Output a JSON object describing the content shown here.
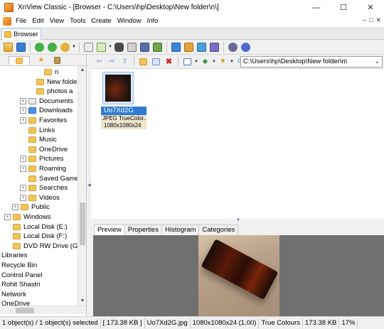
{
  "window": {
    "title": "XnView Classic - [Browser - C:\\Users\\hp\\Desktop\\New folder\\n\\]",
    "minimize": "—",
    "maximize": "☐",
    "close": "✕"
  },
  "menu": {
    "items": [
      "File",
      "Edit",
      "View",
      "Tools",
      "Create",
      "Window",
      "Info"
    ],
    "right_controls": [
      "–",
      "□",
      "✕"
    ]
  },
  "tabs": {
    "browser": "Browser"
  },
  "toolbar": {
    "icons": [
      "folder-up-icon",
      "fullscreen-icon",
      "back-icon",
      "forward-icon",
      "refresh-icon",
      "filter-icon",
      "copy-icon",
      "move-icon",
      "find-icon",
      "print-icon",
      "scan-icon",
      "slideshow-icon",
      "web-page-icon",
      "contact-sheet-icon",
      "convert-icon",
      "multipage-icon",
      "settings-icon",
      "info-icon"
    ]
  },
  "address": {
    "path": "C:\\Users\\hp\\Desktop\\New folder\\n\\"
  },
  "tree": [
    {
      "label": "n",
      "indent": 4,
      "exp": ""
    },
    {
      "label": "New folder",
      "indent": 3,
      "exp": ""
    },
    {
      "label": "photos a",
      "indent": 3,
      "exp": ""
    },
    {
      "label": "Documents",
      "indent": 2,
      "exp": "+"
    },
    {
      "label": "Downloads",
      "indent": 2,
      "exp": "+"
    },
    {
      "label": "Favorites",
      "indent": 2,
      "exp": "+"
    },
    {
      "label": "Links",
      "indent": 2,
      "exp": ""
    },
    {
      "label": "Music",
      "indent": 2,
      "exp": ""
    },
    {
      "label": "OneDrive",
      "indent": 2,
      "exp": ""
    },
    {
      "label": "Pictures",
      "indent": 2,
      "exp": "+"
    },
    {
      "label": "Roaming",
      "indent": 2,
      "exp": "+"
    },
    {
      "label": "Saved Game",
      "indent": 2,
      "exp": ""
    },
    {
      "label": "Searches",
      "indent": 2,
      "exp": "+"
    },
    {
      "label": "Videos",
      "indent": 2,
      "exp": "+"
    },
    {
      "label": "Public",
      "indent": 1,
      "exp": "+"
    },
    {
      "label": "Windows",
      "indent": 0,
      "exp": "+"
    },
    {
      "label": "Local Disk (E:)",
      "indent": 0,
      "exp": ""
    },
    {
      "label": "Local Disk (F:)",
      "indent": 0,
      "exp": ""
    },
    {
      "label": "DVD RW Drive (G:)",
      "indent": 0,
      "exp": ""
    },
    {
      "label": "Libraries",
      "indent": -1,
      "exp": ""
    },
    {
      "label": "Recycle Bin",
      "indent": -1,
      "exp": ""
    },
    {
      "label": "Control Panel",
      "indent": -1,
      "exp": ""
    },
    {
      "label": "Rohit Shastri",
      "indent": -1,
      "exp": ""
    },
    {
      "label": "Network",
      "indent": -1,
      "exp": ""
    },
    {
      "label": "OneDrive",
      "indent": -1,
      "exp": ""
    }
  ],
  "file": {
    "name": "Uo7Xd2G",
    "type": "JPEG TrueColor...",
    "dims": "1080x1080x24"
  },
  "preview_tabs": [
    "Preview",
    "Properties",
    "Histogram",
    "Categories"
  ],
  "status": [
    "1 object(s) / 1 object(s) selected",
    "[ 173.38 KB ]",
    "Uo7Xd2G.jpg",
    "1080x1080x24 (1.00)",
    "True Colours",
    "173.38 KB",
    "17%"
  ]
}
